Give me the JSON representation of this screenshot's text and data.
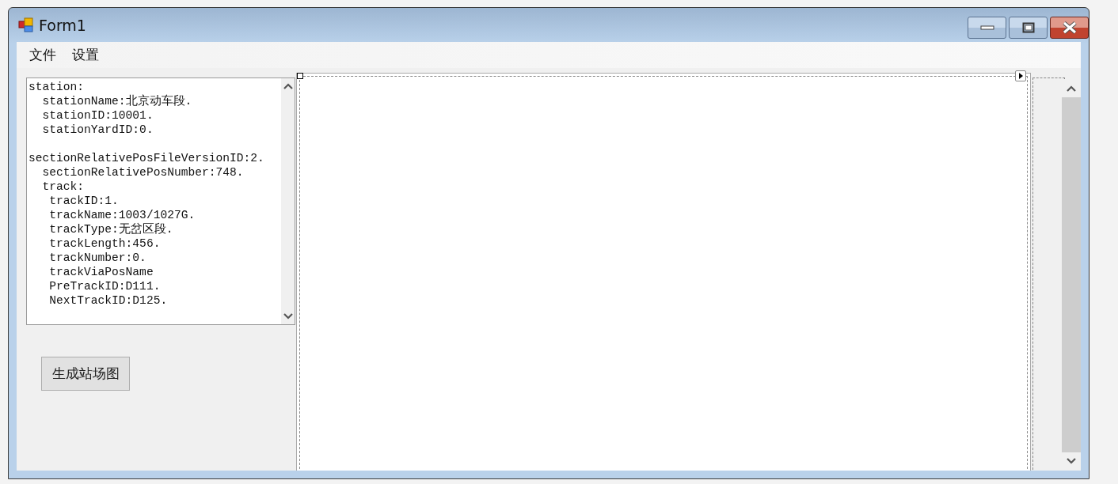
{
  "window": {
    "title": "Form1"
  },
  "menu": [
    "文件",
    "设置"
  ],
  "textbox": {
    "groups": [
      [
        "station:",
        "  stationName:北京动车段.",
        "  stationID:10001.",
        "  stationYardID:0."
      ],
      [
        "sectionRelativePosFileVersionID:2.",
        "  sectionRelativePosNumber:748.",
        "  track:",
        "   trackID:1.",
        "   trackName:1003/1027G.",
        "   trackType:无岔区段.",
        "   trackLength:456.",
        "   trackNumber:0.",
        "   trackViaPosName",
        "   PreTrackID:D111.",
        "   NextTrackID:D125."
      ]
    ]
  },
  "button": {
    "label": "生成站场图"
  }
}
